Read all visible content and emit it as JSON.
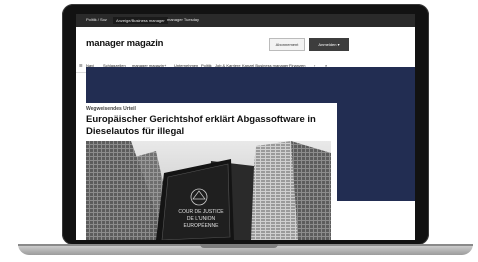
{
  "topbar": {
    "tab_1": "Politik / Soz",
    "tab_2": "Anzeige/Business manager",
    "tab_3": "manager Tuesday"
  },
  "header": {
    "logo": "manager magazin",
    "abo_label": "Abonnement",
    "login_label": "Anmelden"
  },
  "nav": {
    "items": [
      "Navi",
      "Schlagzeilen",
      "manager magazin+",
      "Unternehmen",
      "Politik",
      "Job & Karriere",
      "Kanzel Business manager",
      "Finanzen"
    ]
  },
  "article": {
    "kicker": "Wegweisendes Urteil",
    "headline": "Europäischer Gerichtshof erklärt Abgassoftware in Dieselautos für illegal",
    "image_sign": {
      "line1": "COUR DE JUSTICE",
      "line2": "DE L'UNION",
      "line3": "EUROPÉENNE"
    }
  },
  "colors": {
    "banner": "#222d52",
    "laptop_frame": "#121212"
  }
}
